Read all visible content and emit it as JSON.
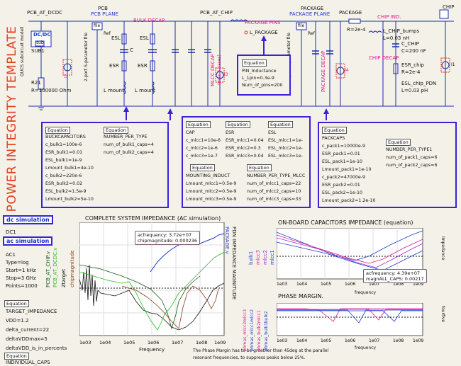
{
  "side_title": "POWER INTEGRITY TEMPLATE",
  "schematic": {
    "labels": {
      "pcb_at_dcdc": "PCB_AT_DCDC",
      "pcb": "PCB",
      "pcb_plane": "PCB PLANE",
      "bulk_decap": "BULK DECAP",
      "pcb_at_chip": "PCB_AT_CHIP",
      "package_pins": "PACKAGE PINS",
      "package": "PACKAGE",
      "package_plane": "PACKAGE PLANE",
      "package2": "PACKAGE",
      "chip_ind": "CHIP IND.",
      "chip": "CHIP",
      "dcdc": "DC/DC",
      "sub": "sub",
      "qucs_model": "QUCS subcircuit modell",
      "sub1": "SUB1",
      "r21": "R21",
      "r21_val": "R=100000 Ohm",
      "i2": "I2",
      "s2p_1": "2-port S-parameter file",
      "file": "file",
      "ref": "Ref",
      "esl": "ESL",
      "c": "C",
      "esr": "ESR",
      "lmount": "L mount",
      "mlcc_decap": "MLCC DECAP",
      "max_bases": "(max 3 bases)",
      "i3": "I3",
      "l_package": "L_PACKAGE",
      "s2p_2": "2-port S-parameter file",
      "package_decap": "PACKAGE DECAP",
      "i4": "I4",
      "r_pkg": "R=2e-4",
      "l_chip_bumps": "L_CHIP_bumps",
      "l_chip_val": "L=0.03 nH",
      "c_chip": "C_CHIP",
      "c_chip_val": "C=200 nF",
      "chip_decap": "CHIP DECAP.",
      "esr_chip": "ESR_chip",
      "esr_chip_val": "R=2e-4",
      "esl_chip": "ESL_chip_PDN",
      "esl_chip_val": "L=0.03 pH",
      "i1": "I1"
    },
    "pin_eq": {
      "title": "Equation",
      "lines": [
        "PIN_Inductance",
        "L_1pin=0.3e-9",
        "Num_of_pins=200"
      ]
    }
  },
  "eq_bulk": {
    "title1": "Equation",
    "title2": "Equation",
    "col1": [
      "BUCKCAPACITORS",
      "c_bulk1=100e-6",
      "ESR_bulk1=0.01",
      "ESL_bulk1=1e-9",
      "Lmount_bulk1=4e-10",
      "c_bulk2=220e-6",
      "ESR_bulk2=0.02",
      "ESL_bulk2=1.5e-9",
      "Lmount_bulk2=5e-10"
    ],
    "col2": [
      "NUMBER_PER_TYPE",
      "num_of_bulk1_caps=4",
      "num_of_bulk2_caps=4"
    ]
  },
  "eq_mlcc": {
    "titles": [
      "Equation",
      "Equation",
      "Equation",
      "Equation",
      "Equation"
    ],
    "cap": [
      "CAP",
      "c_mlcc1=10e-6",
      "c_mlcc2=1e-6",
      "c_mlcc3=1e-7"
    ],
    "esr": [
      "ESR",
      "ESR_mlcc1=0.04",
      "ESR_mlcc2=0.3",
      "ESR_mlcc3=0.04"
    ],
    "esl": [
      "ESL",
      "ESL_mlcc1=1e-",
      "ESL_mlcc2=1e-",
      "ESL_mlcc3=1e-"
    ],
    "mount": [
      "MOUNTING_INDUCT",
      "Lmount_mlcc1=0.5e-9",
      "Lmount_mlcc2=0.5e-9",
      "Lmount_mlcc3=0.5e-9"
    ],
    "num": [
      "NUMBER_PER_TYPE_MLCC",
      "num_of_mlcc1_caps=22",
      "num_of_mlcc2_caps=10",
      "num_of_mlcc3_caps=33"
    ]
  },
  "eq_pack": {
    "title1": "Equation",
    "title2": "Equation",
    "col1": [
      "PACKCAPS",
      "c_pack1=10000e-9",
      "ESR_pack1=0.01",
      "ESL_pack1=1e-10",
      "Lmount_pack1=1e-10",
      "c_pack2=47000e-9",
      "ESR_pack2=0.01",
      "ESL_pack2=1e-10",
      "Lmount_pack2=1.2e-10"
    ],
    "col2": [
      "NUMBER_PER_TYPE1",
      "num_of_pack1_caps=6",
      "num_of_pack2_caps=6"
    ]
  },
  "sim": {
    "dc_btn": "dc simulation",
    "dc1": "DC1",
    "ac_btn": "ac simulation",
    "ac1": "AC1",
    "ac_lines": [
      "Type=log",
      "Start=1 kHz",
      "Stop=3 GHz",
      "Points=1000"
    ],
    "eq_title": "Equation",
    "target": [
      "TARGET_IMPEDANCE",
      "VDD=1.2",
      "delta_current=22",
      "deltaVDDmax=5",
      "deltaVDD_is_in_percents"
    ],
    "eq_title2": "Equation",
    "individual": "INDIVIDUAL_CAPS"
  },
  "main_plot": {
    "title": "COMPLETE SYSTEM IMPEDANCE (AC simulation)",
    "xlabel": "Frequency",
    "ylabels": [
      "PCB_AT_CHIP.v",
      "PCB_AT_DCDC.v",
      "Ztarget",
      "chipmagnitude"
    ],
    "right_labels": [
      "PACKAGE.v",
      "PDN IMPEDANCE MAGNITUDE"
    ],
    "tooltip": [
      "acfrequency: 3.72e+07",
      "chipmagnitude: 0.000236"
    ],
    "note": [
      "The Phase Margin has to be greather than 45deg at the parallel",
      "resonant frequencies, to suppress peaks below 25%."
    ]
  },
  "cap_plot": {
    "title": "ON-BOARD CAPACITORS IMPEDANCE (equation)",
    "xlabel": "frequency",
    "ylabels": [
      "bulk1",
      "mlcc3",
      "mlcc2",
      "mlcc1"
    ],
    "right_label": "Impedance",
    "tooltip": [
      "acfrequency: 4.39e+07",
      "magnALL_CAPS: 0.00217"
    ]
  },
  "phase_plot": {
    "title": "PHASE MARGIN.",
    "xlabel": "frequency",
    "ylabels": [
      "phmas_mlcc2mlcc3",
      "phmas_mlcc1mlcc2",
      "phmas_bulk2mlcc1",
      "phmas_bulk1bulk2"
    ],
    "right_label": "fourfive"
  },
  "chart_data": [
    {
      "type": "line",
      "title": "COMPLETE SYSTEM IMPEDANCE (AC simulation)",
      "xlabel": "Frequency",
      "x_ticks": [
        "1e03",
        "1e04",
        "1e05",
        "1e06",
        "1e07",
        "1e08",
        "1e09"
      ],
      "x_scale": "log",
      "series": [
        {
          "name": "PCB_AT_CHIP.v",
          "color": "#1a5a1a"
        },
        {
          "name": "PCB_AT_DCDC.v",
          "color": "#22c020"
        },
        {
          "name": "Ztarget",
          "color": "#111111"
        },
        {
          "name": "chipmagnitude",
          "color": "#8c3a1a"
        },
        {
          "name": "PACKAGE.v",
          "color": "#1d3bd0"
        }
      ],
      "grid": true
    },
    {
      "type": "line",
      "title": "ON-BOARD CAPACITORS IMPEDANCE (equation)",
      "xlabel": "frequency",
      "x_ticks": [
        "1e03",
        "1e04",
        "1e05",
        "1e06",
        "1e07",
        "1e08",
        "1e09"
      ],
      "x_scale": "log",
      "series": [
        {
          "name": "bulk1",
          "color": "#1d3bd0"
        },
        {
          "name": "mlcc3",
          "color": "#e0168a"
        },
        {
          "name": "mlcc2",
          "color": "#9a2ad0"
        },
        {
          "name": "mlcc1",
          "color": "#1d3bd0"
        }
      ],
      "grid": true
    },
    {
      "type": "line",
      "title": "PHASE MARGIN.",
      "xlabel": "frequency",
      "x_ticks": [
        "1e03",
        "1e04",
        "1e05",
        "1e06",
        "1e07",
        "1e08",
        "1e09"
      ],
      "x_scale": "log",
      "series": [
        {
          "name": "phmas_mlcc2mlcc3",
          "color": "#e0168a"
        },
        {
          "name": "phmas_mlcc1mlcc2",
          "color": "#1d3bd0"
        },
        {
          "name": "phmas_bulk2mlcc1",
          "color": "#e0168a"
        },
        {
          "name": "phmas_bulk1bulk2",
          "color": "#1d3bd0"
        }
      ],
      "grid": true
    }
  ]
}
